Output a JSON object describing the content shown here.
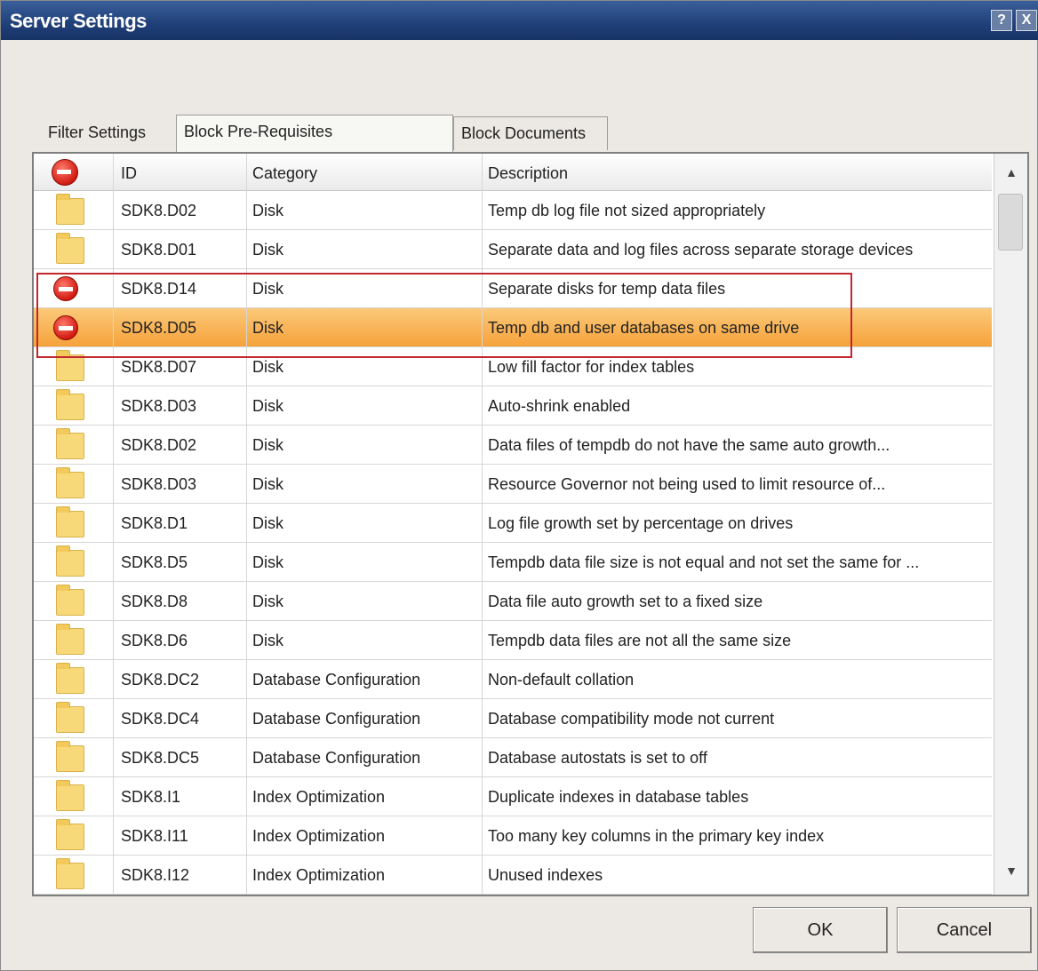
{
  "window": {
    "title": "Server Settings"
  },
  "titlebar_buttons": {
    "help": "?",
    "close": "X"
  },
  "tabs": [
    {
      "label": "Filter Settings"
    },
    {
      "label": "Block Pre-Requisites"
    },
    {
      "label": "Block Documents"
    }
  ],
  "grid": {
    "columns": {
      "id": "ID",
      "category": "Category",
      "description": "Description"
    },
    "rows": [
      {
        "icon": "folder-icon",
        "id": "SDK8.D02",
        "category": "Disk",
        "description": "Temp db log file not sized appropriately",
        "selected": false,
        "flagged": false
      },
      {
        "icon": "folder-icon",
        "id": "SDK8.D01",
        "category": "Disk",
        "description": "Separate data and log files across separate storage devices",
        "selected": false,
        "flagged": false
      },
      {
        "icon": "block-icon",
        "id": "SDK8.D14",
        "category": "Disk",
        "description": "Separate disks for temp data files",
        "selected": false,
        "flagged": true
      },
      {
        "icon": "block-icon",
        "id": "SDK8.D05",
        "category": "Disk",
        "description": "Temp db and user databases on same drive",
        "selected": true,
        "flagged": true
      },
      {
        "icon": "folder-icon",
        "id": "SDK8.D07",
        "category": "Disk",
        "description": "Low fill factor for index tables",
        "selected": false,
        "flagged": false
      },
      {
        "icon": "folder-icon",
        "id": "SDK8.D03",
        "category": "Disk",
        "description": "Auto-shrink enabled",
        "selected": false,
        "flagged": false
      },
      {
        "icon": "folder-icon",
        "id": "SDK8.D02",
        "category": "Disk",
        "description": "Data files of tempdb do not have the same auto growth...",
        "selected": false,
        "flagged": false
      },
      {
        "icon": "folder-icon",
        "id": "SDK8.D03",
        "category": "Disk",
        "description": "Resource Governor not being used to limit resource of...",
        "selected": false,
        "flagged": false
      },
      {
        "icon": "folder-icon",
        "id": "SDK8.D1",
        "category": "Disk",
        "description": "Log file growth set by percentage on drives",
        "selected": false,
        "flagged": false
      },
      {
        "icon": "folder-icon",
        "id": "SDK8.D5",
        "category": "Disk",
        "description": "Tempdb data file size is not equal and not set the same for ...",
        "selected": false,
        "flagged": false
      },
      {
        "icon": "folder-icon",
        "id": "SDK8.D8",
        "category": "Disk",
        "description": "Data file auto growth set to a fixed size",
        "selected": false,
        "flagged": false
      },
      {
        "icon": "folder-icon",
        "id": "SDK8.D6",
        "category": "Disk",
        "description": "Tempdb data files are not all the same size",
        "selected": false,
        "flagged": false
      },
      {
        "icon": "folder-icon",
        "id": "SDK8.DC2",
        "category": "Database Configuration",
        "description": "Non-default collation",
        "selected": false,
        "flagged": false
      },
      {
        "icon": "folder-icon",
        "id": "SDK8.DC4",
        "category": "Database Configuration",
        "description": "Database compatibility mode not current",
        "selected": false,
        "flagged": false
      },
      {
        "icon": "folder-icon",
        "id": "SDK8.DC5",
        "category": "Database Configuration",
        "description": "Database autostats is set to off",
        "selected": false,
        "flagged": false
      },
      {
        "icon": "folder-icon",
        "id": "SDK8.I1",
        "category": "Index Optimization",
        "description": "Duplicate indexes in database tables",
        "selected": false,
        "flagged": false
      },
      {
        "icon": "folder-icon",
        "id": "SDK8.I11",
        "category": "Index Optimization",
        "description": "Too many key columns in the primary key index",
        "selected": false,
        "flagged": false
      },
      {
        "icon": "folder-icon",
        "id": "SDK8.I12",
        "category": "Index Optimization",
        "description": "Unused indexes",
        "selected": false,
        "flagged": false
      }
    ]
  },
  "buttons": {
    "ok": "OK",
    "cancel": "Cancel"
  },
  "colors": {
    "title_bar": "#1f3f78",
    "selected_row": "#f6a23a",
    "highlight_box": "#c0262b",
    "block_icon": "#d21b12",
    "folder_icon": "#f8d97a"
  }
}
